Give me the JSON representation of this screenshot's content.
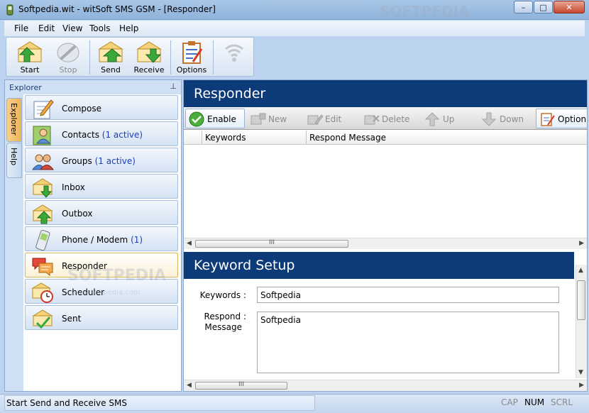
{
  "window": {
    "title": "Softpedia.wit - witSoft SMS GSM - [Responder]",
    "buttons": {
      "minimize": "–",
      "maximize": "□",
      "close": "✕"
    }
  },
  "menubar": {
    "items": [
      "File",
      "Edit",
      "View",
      "Tools",
      "Help"
    ]
  },
  "toolbar": {
    "start": "Start",
    "stop": "Stop",
    "send": "Send",
    "receive": "Receive",
    "options": "Options"
  },
  "explorer": {
    "title": "Explorer",
    "pin": "⊥",
    "tabs": [
      "Explorer",
      "Help"
    ],
    "items": [
      {
        "label": "Compose",
        "badge": ""
      },
      {
        "label": "Contacts",
        "badge": "(1 active)"
      },
      {
        "label": "Groups",
        "badge": "(1 active)"
      },
      {
        "label": "Inbox",
        "badge": ""
      },
      {
        "label": "Outbox",
        "badge": ""
      },
      {
        "label": "Phone / Modem",
        "badge": "(1)"
      },
      {
        "label": "Responder",
        "badge": ""
      },
      {
        "label": "Scheduler",
        "badge": ""
      },
      {
        "label": "Sent",
        "badge": ""
      }
    ],
    "active": "Responder"
  },
  "responder": {
    "title": "Responder",
    "toolbar": {
      "enable": "Enable",
      "new": "New",
      "edit": "Edit",
      "delete": "Delete",
      "up": "Up",
      "down": "Down",
      "options": "Option"
    },
    "columns": [
      "Keywords",
      "Respond Message"
    ],
    "rows": []
  },
  "keyword_setup": {
    "title": "Keyword Setup",
    "keywords_label": "Keywords :",
    "keywords_value": "Softpedia",
    "message_label_1": "Respond :",
    "message_label_2": "Message",
    "message_value": "Softpedia"
  },
  "statusbar": {
    "message": "Start Send and Receive SMS",
    "cap": "CAP",
    "num": "NUM",
    "scrl": "SCRL"
  },
  "watermark": {
    "brand": "SOFTPEDIA",
    "url": "www.softpedia.com"
  },
  "colors": {
    "section_header": "#0d3a78",
    "active_item": "#fbf1d6",
    "badge_text": "#1c3db8"
  }
}
